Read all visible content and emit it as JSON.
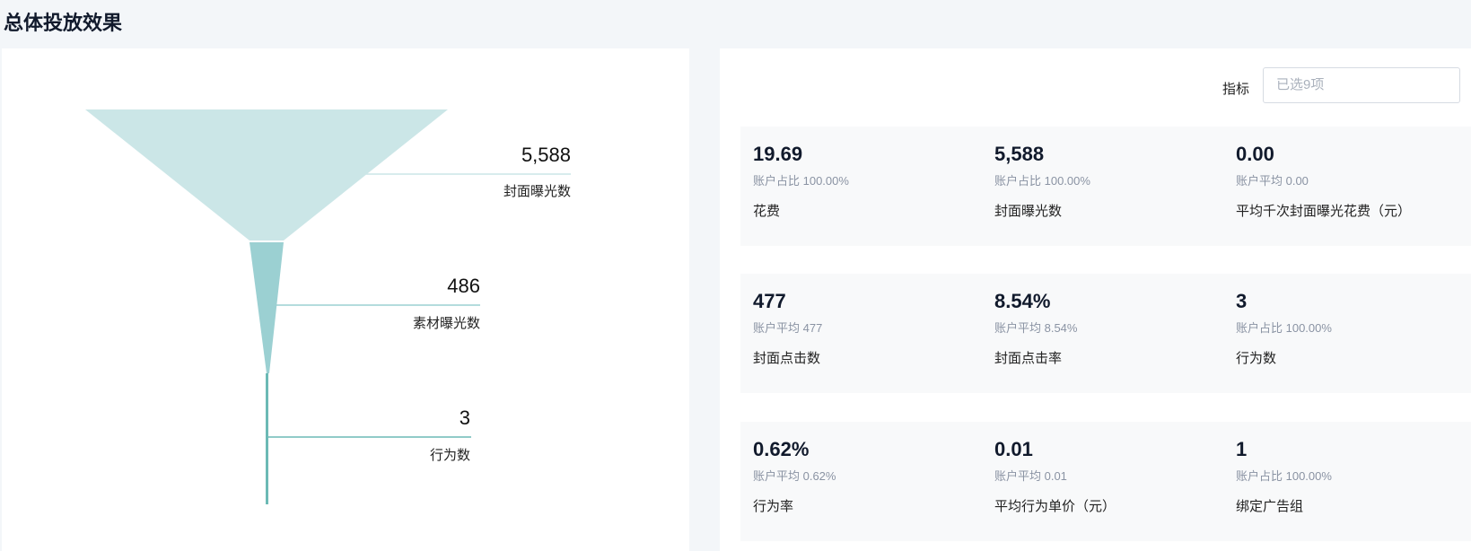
{
  "title": "总体投放效果",
  "funnel": [
    {
      "value": "5,588",
      "label": "封面曝光数"
    },
    {
      "value": "486",
      "label": "素材曝光数"
    },
    {
      "value": "3",
      "label": "行为数"
    }
  ],
  "colors": {
    "stage1": "#cbe6e7",
    "stage2": "#9bd0d2",
    "stage3": "#6cbab5"
  },
  "indicator": {
    "label": "指标",
    "placeholder": "已选9项"
  },
  "metrics": [
    [
      {
        "value": "19.69",
        "sub": "账户占比 100.00%",
        "name": "花费"
      },
      {
        "value": "5,588",
        "sub": "账户占比 100.00%",
        "name": "封面曝光数"
      },
      {
        "value": "0.00",
        "sub": "账户平均 0.00",
        "name": "平均千次封面曝光花费（元）"
      }
    ],
    [
      {
        "value": "477",
        "sub": "账户平均 477",
        "name": "封面点击数"
      },
      {
        "value": "8.54%",
        "sub": "账户平均 8.54%",
        "name": "封面点击率"
      },
      {
        "value": "3",
        "sub": "账户占比 100.00%",
        "name": "行为数"
      }
    ],
    [
      {
        "value": "0.62%",
        "sub": "账户平均 0.62%",
        "name": "行为率"
      },
      {
        "value": "0.01",
        "sub": "账户平均 0.01",
        "name": "平均行为单价（元）"
      },
      {
        "value": "1",
        "sub": "账户占比 100.00%",
        "name": "绑定广告组"
      }
    ]
  ]
}
